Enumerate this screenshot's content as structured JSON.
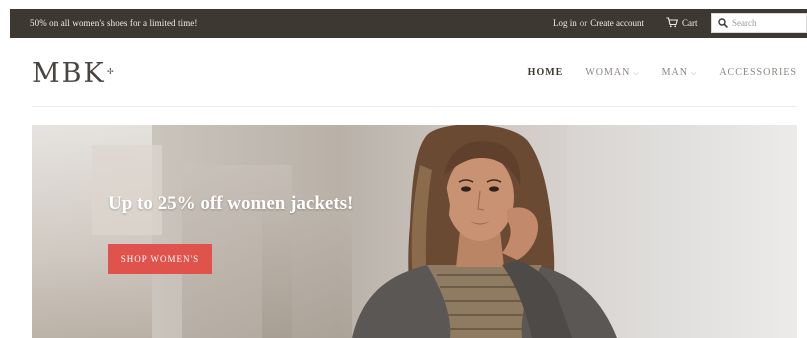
{
  "topbar": {
    "promo": "50% on all women's shoes for a limited time!",
    "login": "Log in",
    "or": "or",
    "create_account": "Create account",
    "cart": "Cart",
    "search_placeholder": "Search"
  },
  "logo": {
    "text": "MBK",
    "mark": "✢"
  },
  "nav": {
    "items": [
      {
        "label": "HOME",
        "active": true
      },
      {
        "label": "WOMAN",
        "dropdown": true
      },
      {
        "label": "MAN",
        "dropdown": true
      },
      {
        "label": "ACCESSORIES"
      }
    ],
    "chevron": "⌵"
  },
  "hero": {
    "headline": "Up to 25% off women jackets!",
    "cta": "SHOP WOMEN'S"
  },
  "colors": {
    "topbar_bg": "#3e3833",
    "cta_bg": "#e0534d",
    "nav_active": "#3e3833",
    "nav_inactive": "#8c8580"
  },
  "icons": {
    "cart": "cart-icon",
    "search": "search-icon"
  }
}
